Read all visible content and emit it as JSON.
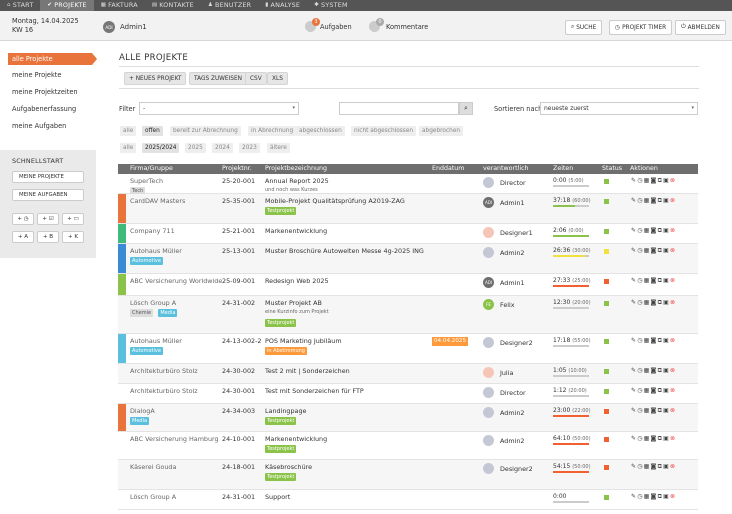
{
  "nav": [
    {
      "icon": "home-icon",
      "glyph": "⌂",
      "label": "START"
    },
    {
      "icon": "pin-icon",
      "glyph": "✔",
      "label": "PROJEKTE",
      "active": true
    },
    {
      "icon": "invoice-icon",
      "glyph": "▦",
      "label": "FAKTURA"
    },
    {
      "icon": "contacts-icon",
      "glyph": "▤",
      "label": "KONTAKTE"
    },
    {
      "icon": "user-icon",
      "glyph": "♟",
      "label": "BENUTZER"
    },
    {
      "icon": "chart-icon",
      "glyph": "▮",
      "label": "ANALYSE"
    },
    {
      "icon": "gear-icon",
      "glyph": "✱",
      "label": "SYSTEM"
    }
  ],
  "header": {
    "date": "Montag, 14.04.2025",
    "week": "KW 16",
    "user_initials": "ADI",
    "user": "Admin1",
    "tasks_count": "3",
    "tasks_label": "Aufgaben",
    "comments_count": "0",
    "comments_label": "Kommentare",
    "search": "SUCHE",
    "timer": "PROJEKT TIMER",
    "logout": "ABMELDEN"
  },
  "sidebar": {
    "items": [
      "alle Projekte",
      "meine Projekte",
      "meine Projektzeiten",
      "Aufgabenerfassung",
      "meine Aufgaben"
    ],
    "quick_title": "SCHNELLSTART",
    "quick_buttons": [
      "MEINE PROJEKTE",
      "MEINE AUFGABEN"
    ],
    "quick_icons": [
      "+ ◷",
      "+ ☑",
      "+ ▭",
      "+ A",
      "+ B",
      "+ K"
    ]
  },
  "main": {
    "title": "ALLE PROJEKTE",
    "toolbar": [
      "+ NEUES PROJEKT",
      "TAGS ZUWEISEN",
      "CSV",
      "XLS"
    ],
    "filter_label": "Filter",
    "filter_value": "-",
    "sort_label": "Sortieren nach",
    "sort_value": "neueste zuerst",
    "status_chips": [
      {
        "label": "alle"
      },
      {
        "label": "offen",
        "active": true
      },
      {
        "label": "bereit zur Abrechnung"
      },
      {
        "label": "in Abrechnung"
      },
      {
        "label": "abgeschlossen"
      },
      {
        "label": "nicht abgeschlossen"
      },
      {
        "label": "abgebrochen"
      }
    ],
    "year_chips": [
      {
        "label": "alle"
      },
      {
        "label": "2025/2024",
        "active": true
      },
      {
        "label": "2025"
      },
      {
        "label": "2024"
      },
      {
        "label": "2023"
      },
      {
        "label": "ältere"
      }
    ]
  },
  "table": {
    "headers": [
      "Firma/Gruppe",
      "Projektnr.",
      "Projektbezeichnung",
      "Enddatum",
      "verantwortlich",
      "Zeiten",
      "Status",
      "Aktionen"
    ],
    "rows": [
      {
        "company": "SuperTech",
        "tags": [
          {
            "t": "Tech",
            "c": "gray"
          }
        ],
        "nr": "25-20-001",
        "name": "Annual Report 2025",
        "sub": "und noch was Kurzes",
        "ptags": [],
        "enddate": "",
        "person": "Director",
        "av": "p",
        "time": "0:00",
        "budget": "(5:00)",
        "bar": "#ccc",
        "barw": 0,
        "status": "#8bc34a",
        "color": "",
        "h": 20
      },
      {
        "company": "CardDAV Masters",
        "tags": [],
        "nr": "25-35-001",
        "name": "Mobile-Projekt Qualitätsprüfung A2019-ZAG",
        "sub": "",
        "ptags": [
          {
            "t": "Testprojekt",
            "c": "green"
          }
        ],
        "enddate": "",
        "person": "Admin1",
        "av": "abc",
        "time": "37:18",
        "budget": "(60:00)",
        "bar": "#8bc34a",
        "barw": 0.62,
        "status": "#8bc34a",
        "color": "#e8743b",
        "h": 30
      },
      {
        "company": "Company 711",
        "tags": [],
        "nr": "25-21-001",
        "name": "Markenentwicklung",
        "sub": "",
        "ptags": [],
        "enddate": "",
        "person": "Designer1",
        "av": "c",
        "time": "2:06",
        "budget": "(0:00)",
        "bar": "#8bc34a",
        "barw": 1,
        "status": "#8bc34a",
        "color": "#3fba7a",
        "h": 20
      },
      {
        "company": "Autohaus Müller",
        "tags": [
          {
            "t": "Automotive",
            "c": "blue"
          }
        ],
        "nr": "25-13-001",
        "name": "Muster Broschüre Autowelten Messe 4g-2025 ING",
        "sub": "",
        "ptags": [],
        "enddate": "",
        "person": "Admin2",
        "av": "p",
        "time": "26:36",
        "budget": "(30:00)",
        "bar": "#f0e040",
        "barw": 0.89,
        "status": "#f0e040",
        "color": "#3a8bd6",
        "h": 30
      },
      {
        "company": "ABC Versicherung Worldwide",
        "tags": [],
        "nr": "25-09-001",
        "name": "Redesign Web 2025",
        "sub": "",
        "ptags": [],
        "enddate": "",
        "person": "Admin1",
        "av": "abc",
        "time": "27:33",
        "budget": "(25:00)",
        "bar": "#f06030",
        "barw": 1,
        "status": "#f06030",
        "color": "#8bc34a",
        "h": 22
      },
      {
        "company": "Lösch Group A",
        "tags": [
          {
            "t": "Chemie",
            "c": "gray"
          },
          {
            "t": "Media",
            "c": "blue"
          }
        ],
        "nr": "24-31-002",
        "name": "Muster Projekt AB",
        "sub": "eine Kurzinfo zum Projekt",
        "ptags": [
          {
            "t": "Testprojekt",
            "c": "green"
          }
        ],
        "enddate": "",
        "person": "Felix",
        "av": "g",
        "time": "12:30",
        "budget": "(20:00)",
        "bar": "#ccc",
        "barw": 0.62,
        "status": "#8bc34a",
        "color": "",
        "h": 38
      },
      {
        "company": "Autohaus Müller",
        "tags": [
          {
            "t": "Automotive",
            "c": "blue"
          }
        ],
        "nr": "24-13-002-2",
        "name": "POS Marketing Jubiläum",
        "sub": "",
        "ptags": [
          {
            "t": "in Abstimmung",
            "c": "orange"
          }
        ],
        "enddate": "04.04.2025",
        "person": "Designer2",
        "av": "p",
        "time": "17:18",
        "budget": "(55:00)",
        "bar": "#ccc",
        "barw": 0.31,
        "status": "#8bc34a",
        "color": "#5bc0de",
        "h": 30
      },
      {
        "company": "Architekturbüro Stolz",
        "tags": [],
        "nr": "24-30-002",
        "name": "Test 2 mit | Sonderzeichen",
        "sub": "",
        "ptags": [],
        "enddate": "",
        "person": "Julia",
        "av": "c",
        "time": "1:05",
        "budget": "(10:00)",
        "bar": "#ccc",
        "barw": 0.11,
        "status": "#8bc34a",
        "color": "",
        "h": 20
      },
      {
        "company": "Architekturbüro Stolz",
        "tags": [],
        "nr": "24-30-001",
        "name": "Test mit Sonderzeichen für FTP",
        "sub": "",
        "ptags": [],
        "enddate": "",
        "person": "Director",
        "av": "p",
        "time": "1:12",
        "budget": "(20:00)",
        "bar": "#ccc",
        "barw": 0.06,
        "status": "#8bc34a",
        "color": "",
        "h": 20
      },
      {
        "company": "DialogA",
        "tags": [
          {
            "t": "Media",
            "c": "blue"
          }
        ],
        "nr": "24-34-003",
        "name": "Landingpage",
        "sub": "",
        "ptags": [
          {
            "t": "Testprojekt",
            "c": "green"
          }
        ],
        "enddate": "",
        "person": "Admin2",
        "av": "p",
        "time": "23:00",
        "budget": "(22:00)",
        "bar": "#f06030",
        "barw": 1,
        "status": "#f06030",
        "color": "#e8743b",
        "h": 28
      },
      {
        "company": "ABC Versicherung Hamburg",
        "tags": [],
        "nr": "24-10-001",
        "name": "Markenentwicklung",
        "sub": "",
        "ptags": [
          {
            "t": "Testprojekt",
            "c": "green"
          }
        ],
        "enddate": "",
        "person": "Admin2",
        "av": "p",
        "time": "64:10",
        "budget": "(50:00)",
        "bar": "#f06030",
        "barw": 1,
        "status": "#f06030",
        "color": "",
        "h": 28
      },
      {
        "company": "Käserei Gouda",
        "tags": [],
        "nr": "24-18-001",
        "name": "Käsebroschüre",
        "sub": "",
        "ptags": [
          {
            "t": "Testprojekt",
            "c": "green"
          }
        ],
        "enddate": "",
        "person": "Designer2",
        "av": "p",
        "time": "54:15",
        "budget": "(50:00)",
        "bar": "#f06030",
        "barw": 1,
        "status": "#f06030",
        "color": "",
        "h": 30
      },
      {
        "company": "Lösch Group A",
        "tags": [],
        "nr": "24-31-001",
        "name": "Support",
        "sub": "",
        "ptags": [],
        "enddate": "",
        "person": "",
        "av": "p",
        "time": "0:00",
        "budget": "",
        "bar": "#ccc",
        "barw": 0,
        "status": "#8bc34a",
        "color": "",
        "h": 20
      }
    ]
  }
}
